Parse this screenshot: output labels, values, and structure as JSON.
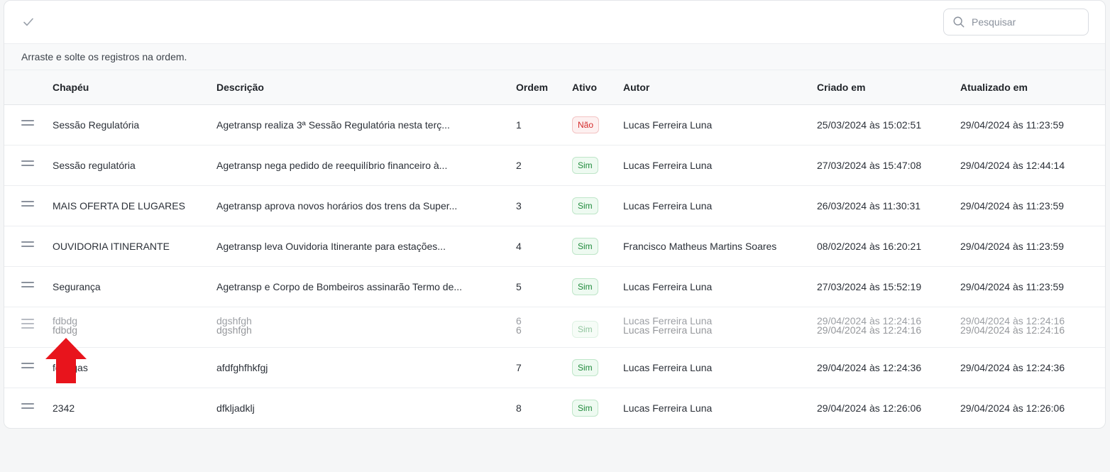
{
  "toolbar": {
    "search_placeholder": "Pesquisar"
  },
  "hint": "Arraste e solte os registros na ordem.",
  "columns": {
    "chapeu": "Chapéu",
    "descricao": "Descrição",
    "ordem": "Ordem",
    "ativo": "Ativo",
    "autor": "Autor",
    "criado": "Criado em",
    "atualizado": "Atualizado em"
  },
  "rows": [
    {
      "chapeu": "Sessão Regulatória",
      "descricao": "Agetransp realiza 3ª Sessão Regulatória nesta terç...",
      "ordem": "1",
      "ativo": "Não",
      "autor": "Lucas Ferreira Luna",
      "criado": "25/03/2024 às 15:02:51",
      "atualizado": "29/04/2024 às 11:23:59"
    },
    {
      "chapeu": "Sessão regulatória",
      "descricao": "Agetransp nega pedido de reequilíbrio financeiro à...",
      "ordem": "2",
      "ativo": "Sim",
      "autor": "Lucas Ferreira Luna",
      "criado": "27/03/2024 às 15:47:08",
      "atualizado": "29/04/2024 às 12:44:14"
    },
    {
      "chapeu": "MAIS OFERTA DE LUGARES",
      "descricao": "Agetransp aprova novos horários dos trens da Super...",
      "ordem": "3",
      "ativo": "Sim",
      "autor": "Lucas Ferreira Luna",
      "criado": "26/03/2024 às 11:30:31",
      "atualizado": "29/04/2024 às 11:23:59"
    },
    {
      "chapeu": "OUVIDORIA ITINERANTE",
      "descricao": "Agetransp leva Ouvidoria Itinerante para estações...",
      "ordem": "4",
      "ativo": "Sim",
      "autor": "Francisco Matheus Martins Soares",
      "criado": "08/02/2024 às 16:20:21",
      "atualizado": "29/04/2024 às 11:23:59"
    },
    {
      "chapeu": "Segurança",
      "descricao": "Agetransp e Corpo de Bombeiros assinarão Termo de...",
      "ordem": "5",
      "ativo": "Sim",
      "autor": "Lucas Ferreira Luna",
      "criado": "27/03/2024 às 15:52:19",
      "atualizado": "29/04/2024 às 11:23:59"
    },
    {
      "chapeu": "fdbdg",
      "descricao": "dgshfgh",
      "ordem": "6",
      "ativo": "Sim",
      "autor": "Lucas Ferreira Luna",
      "criado": "29/04/2024 às 12:24:16",
      "atualizado": "29/04/2024 às 12:24:16"
    },
    {
      "chapeu": "fdbdgas",
      "descricao": "afdfghfhkfgj",
      "ordem": "7",
      "ativo": "Sim",
      "autor": "Lucas Ferreira Luna",
      "criado": "29/04/2024 às 12:24:36",
      "atualizado": "29/04/2024 às 12:24:36"
    },
    {
      "chapeu": "2342",
      "descricao": "dfkljadklj",
      "ordem": "8",
      "ativo": "Sim",
      "autor": "Lucas Ferreira Luna",
      "criado": "29/04/2024 às 12:26:06",
      "atualizado": "29/04/2024 às 12:26:06"
    }
  ],
  "colors": {
    "accent_red": "#e8141c"
  }
}
